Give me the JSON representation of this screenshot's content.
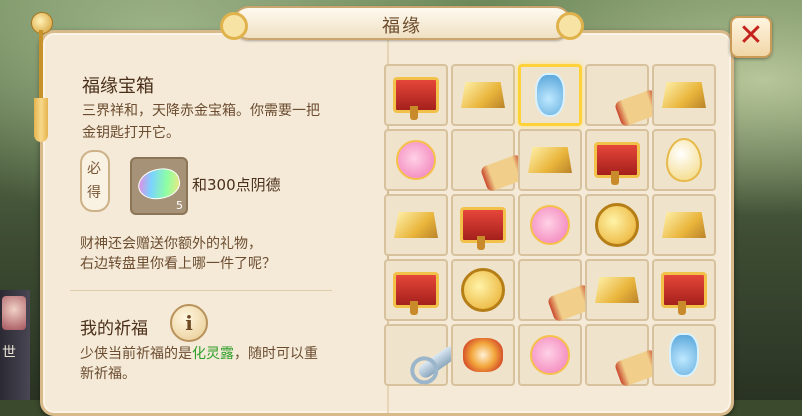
{
  "window": {
    "title": "福缘",
    "close_label": "✕"
  },
  "left_strip": {
    "label": "世"
  },
  "treasure": {
    "heading": "福缘宝箱",
    "description": "三界祥和，天降赤金宝箱。你需要一把金钥匙打开它。",
    "must_get_label": [
      "必",
      "得"
    ],
    "reward_count": "5",
    "reward_text": "和300点阴德",
    "extra_text_line1": "财神还会赠送你额外的礼物，",
    "extra_text_line2": "右边转盘里你看上哪一件了呢？"
  },
  "blessing": {
    "heading": "我的祈福",
    "info_label": "i",
    "text_prefix": "少侠当前祈福的是",
    "text_highlight": "化灵露",
    "text_suffix": "，随时可以重新祈福。",
    "highlight_color": "#2f9f2a"
  },
  "grid": {
    "selected_index": 2,
    "items": [
      "hammer-icon",
      "gold-ingot-icon",
      "vase-icon",
      "scroll-icon",
      "gold-ingot-icon",
      "lucky-bag-icon",
      "scroll-icon",
      "gold-ingot-icon",
      "hammer-icon",
      "egg-icon",
      "gold-ingot-icon",
      "hammer-icon",
      "lucky-bag-icon",
      "gold-coin-icon",
      "gold-ingot-icon",
      "hammer-icon",
      "gold-coin-icon",
      "scroll-icon",
      "gold-ingot-icon",
      "hammer-icon",
      "key-icon",
      "flower-token-icon",
      "lucky-bag-icon",
      "scroll-icon",
      "vase-icon"
    ]
  }
}
